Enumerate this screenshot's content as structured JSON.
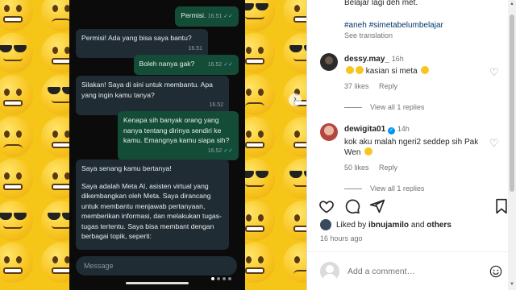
{
  "chat": {
    "messages": [
      {
        "dir": "out",
        "text": "Permisi.",
        "time": "16.51"
      },
      {
        "dir": "in",
        "text": "Permisi! Ada yang bisa saya bantu?",
        "time": "16.51"
      },
      {
        "dir": "out",
        "text": "Boleh nanya gak?",
        "time": "16.52"
      },
      {
        "dir": "in",
        "text": "Silakan! Saya di sini untuk membantu. Apa yang ingin kamu tanya?",
        "time": "16.52"
      },
      {
        "dir": "out",
        "text": "Kenapa sih banyak orang yang nanya tentang dirinya sendiri ke kamu. Emangnya kamu siapa sih?",
        "time": "16.52"
      },
      {
        "dir": "in",
        "text": "Saya senang kamu bertanya!",
        "text2": "Saya adalah Meta AI, asisten virtual yang dikembangkan oleh Meta. Saya dirancang untuk membantu menjawab pertanyaan, memberikan informasi, dan melakukan tugas-tugas tertentu. Saya bisa membant dengan berbagai topik, seperti:",
        "time": ""
      }
    ],
    "input_placeholder": "Message"
  },
  "post": {
    "caption_tail": "Belajar lagi deh met.",
    "hashtags": "#aneh #simetabelumbelajar",
    "see_translation": "See translation"
  },
  "comments": [
    {
      "user": "dessy.may_",
      "time": "16h",
      "text": "kasian si meta",
      "likes": "37 likes",
      "reply": "Reply",
      "view_replies": "View all 1 replies",
      "verified": false
    },
    {
      "user": "dewigita01",
      "time": "14h",
      "text": "kok aku malah ngeri2 seddep sih Pak Wen",
      "likes": "50 likes",
      "reply": "Reply",
      "view_replies": "View all 1 replies",
      "verified": true
    }
  ],
  "liked_by": {
    "prefix": "Liked by",
    "user": "ibnujamilo",
    "and": "and",
    "others": "others"
  },
  "posted_ago": "16 hours ago",
  "comment_placeholder": "Add a comment…",
  "colors": {
    "out_bubble": "#144d37",
    "in_bubble": "#202c33",
    "link": "#00376b",
    "verified": "#0095f6"
  }
}
